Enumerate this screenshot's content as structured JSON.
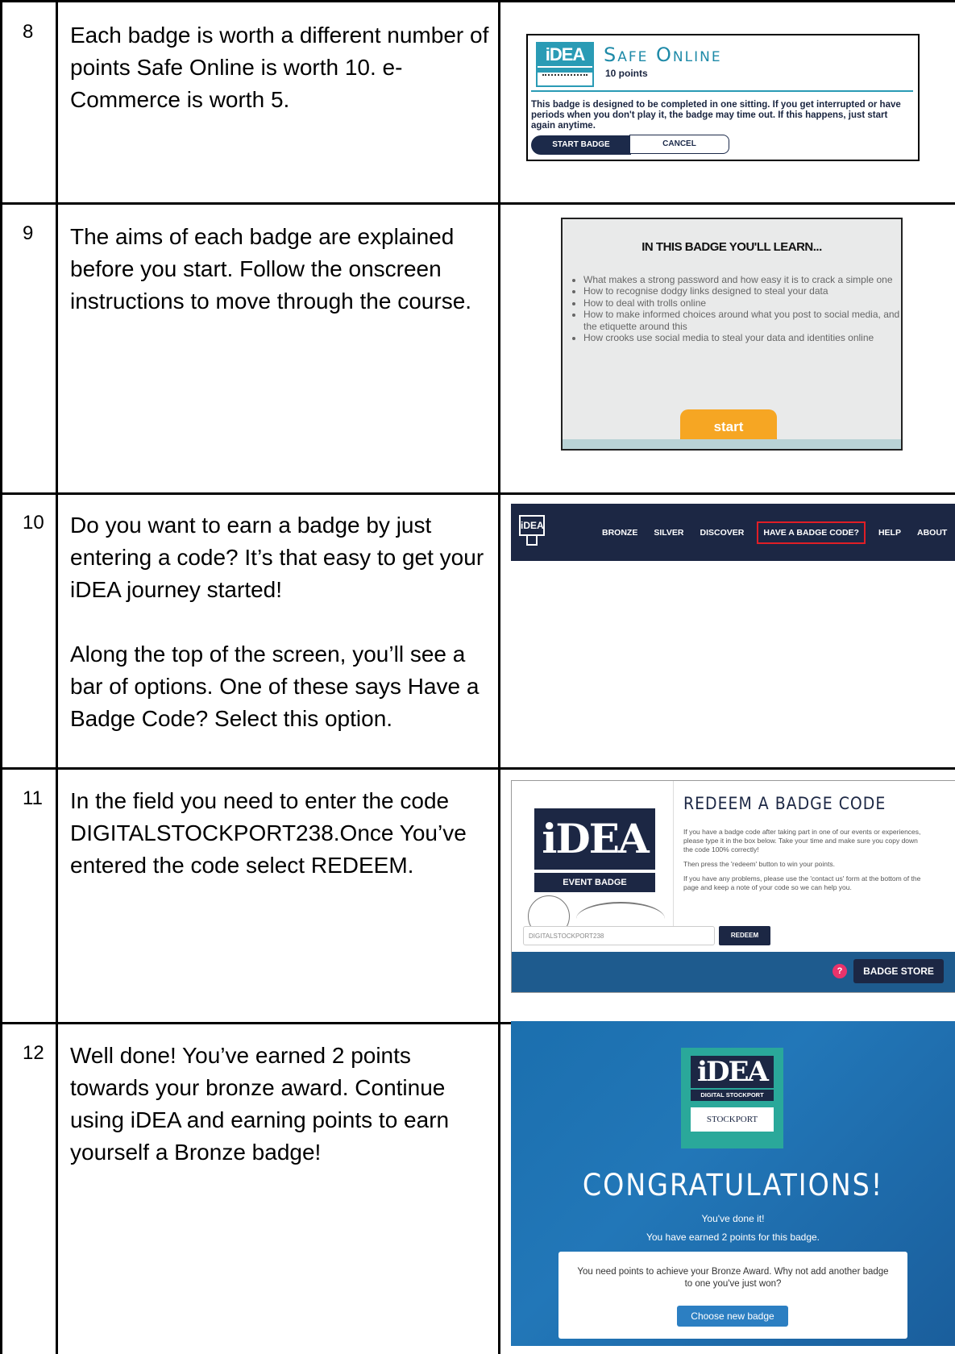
{
  "rows": [
    {
      "number": "8",
      "text": "Each badge is worth a different number of points Safe Online is worth 10. e-Commerce is worth 5."
    },
    {
      "number": "9",
      "text": "The aims of each badge are explained before you start. Follow the onscreen instructions to move through the course."
    },
    {
      "number": "10",
      "text": "Do you want to earn a badge by just entering a code? It’s that easy to get your iDEA journey started!",
      "text2": "Along the top of the screen, you’ll see a bar of options. One of these says Have a Badge Code? Select this option."
    },
    {
      "number": "11",
      "text": "In the field you need to enter the code DIGITALSTOCKPORT238.Once You’ve entered the code select REDEEM."
    },
    {
      "number": "12",
      "text": "Well done! You’ve earned 2 points towards your bronze award. Continue using iDEA and earning points to earn yourself a Bronze badge!"
    }
  ],
  "safe_online": {
    "logo_text": "iDEA",
    "logo_sub": "SAFE ONLINE",
    "title": "Safe Online",
    "points": "10 points",
    "description": "This badge is designed to be completed in one sitting. If you get interrupted or have periods when you don't play it, the badge may time out. If this happens, just start again anytime.",
    "start_label": "START BADGE",
    "cancel_label": "CANCEL"
  },
  "learn": {
    "title": "IN THIS BADGE YOU'LL LEARN...",
    "items": [
      "What makes a strong password and how easy it is to crack a simple one",
      "How to recognise dodgy links designed to steal your data",
      "How to deal with trolls online",
      "How to make informed choices around what you post to social media, and the etiquette around this",
      "How crooks use social media to steal your data and identities online"
    ],
    "start_label": "start"
  },
  "nav": {
    "logo_text": "iDEA",
    "items": [
      "BRONZE",
      "SILVER",
      "DISCOVER",
      "HAVE A BADGE CODE?",
      "HELP",
      "ABOUT"
    ],
    "highlight_color": "#e01e26"
  },
  "redeem": {
    "logo_text": "iDEA",
    "event_badge": "EVENT BADGE",
    "title": "REDEEM A BADGE CODE",
    "p1": "If you have a badge code after taking part in one of our events or experiences, please type it in the box below. Take your time and make sure you copy down the code 100% correctly!",
    "p2": "Then press the 'redeem' button to win your points.",
    "p3": "If you have any problems, please use the 'contact us' form at the bottom of the page and keep a note of your code so we can help you.",
    "input_value": "DIGITALSTOCKPORT238",
    "redeem_label": "REDEEM",
    "help_icon": "?",
    "store_label": "BADGE STORE"
  },
  "congrats": {
    "logo_text": "iDEA",
    "logo_sub": "DIGITAL STOCKPORT",
    "council": "STOCKPORT",
    "title": "CONGRATULATIONS!",
    "line1": "You've done it!",
    "line2": "You have earned 2 points for this badge.",
    "card_text": "You need points to achieve your Bronze Award. Why not add another badge to one you've just won?",
    "button_label": "Choose new badge"
  }
}
